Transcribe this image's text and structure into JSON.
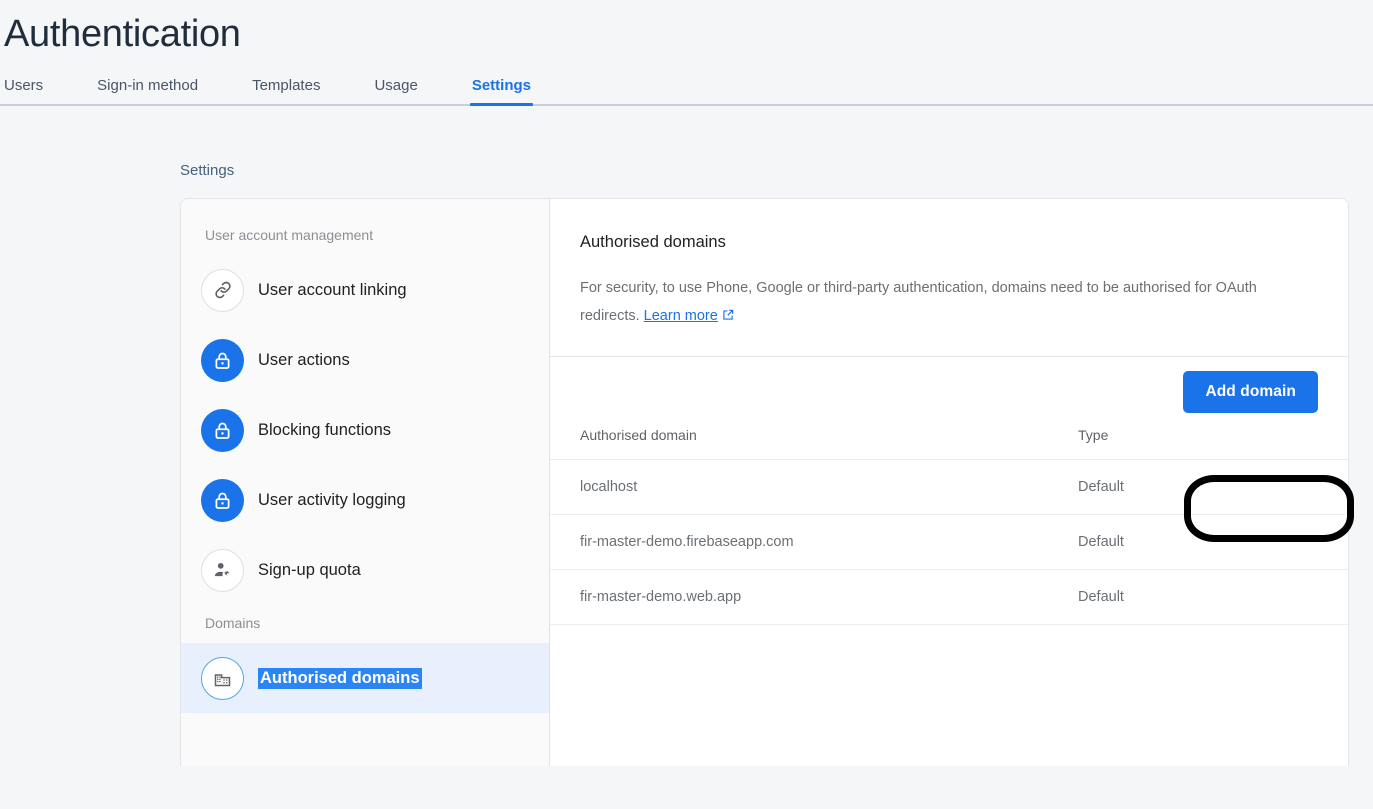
{
  "header": {
    "title": "Authentication",
    "tabs": [
      {
        "label": "Users",
        "active": false
      },
      {
        "label": "Sign-in method",
        "active": false
      },
      {
        "label": "Templates",
        "active": false
      },
      {
        "label": "Usage",
        "active": false
      },
      {
        "label": "Settings",
        "active": true
      }
    ]
  },
  "page": {
    "section_label": "Settings"
  },
  "sidepanel": {
    "groups": [
      {
        "label": "User account management",
        "items": [
          {
            "label": "User account linking",
            "icon": "link-icon",
            "icon_style": "plain",
            "selected": false
          },
          {
            "label": "User actions",
            "icon": "lock-icon",
            "icon_style": "blue",
            "selected": false
          },
          {
            "label": "Blocking functions",
            "icon": "lock-icon",
            "icon_style": "blue",
            "selected": false
          },
          {
            "label": "User activity logging",
            "icon": "lock-icon",
            "icon_style": "blue",
            "selected": false
          },
          {
            "label": "Sign-up quota",
            "icon": "manage-accounts-icon",
            "icon_style": "plain",
            "selected": false
          }
        ]
      },
      {
        "label": "Domains",
        "items": [
          {
            "label": "Authorised domains",
            "icon": "domain-building-icon",
            "icon_style": "ring",
            "selected": true
          }
        ]
      }
    ]
  },
  "detail": {
    "title": "Authorised domains",
    "description_before_link": "For security, to use Phone, Google or third-party authentication, domains need to be authorised for OAuth redirects. ",
    "link_text": "Learn more",
    "link_icon": "external-link-icon",
    "add_domain_button": "Add domain",
    "table": {
      "columns": [
        "Authorised domain",
        "Type"
      ],
      "rows": [
        {
          "domain": "localhost",
          "type": "Default"
        },
        {
          "domain": "fir-master-demo.firebaseapp.com",
          "type": "Default"
        },
        {
          "domain": "fir-master-demo.web.app",
          "type": "Default"
        }
      ]
    }
  },
  "annotation": {
    "shape": "black-oval-highlight",
    "targets": "add-domain-button"
  },
  "colors": {
    "accent_blue": "#1a73e8",
    "selected_row_bg": "#e8f0fe",
    "text_selection_blue": "#2b85f5",
    "page_bg": "#f5f6f7",
    "card_bg": "#ffffff",
    "sidepanel_bg": "#fafafa",
    "annotation_black": "#000000"
  }
}
